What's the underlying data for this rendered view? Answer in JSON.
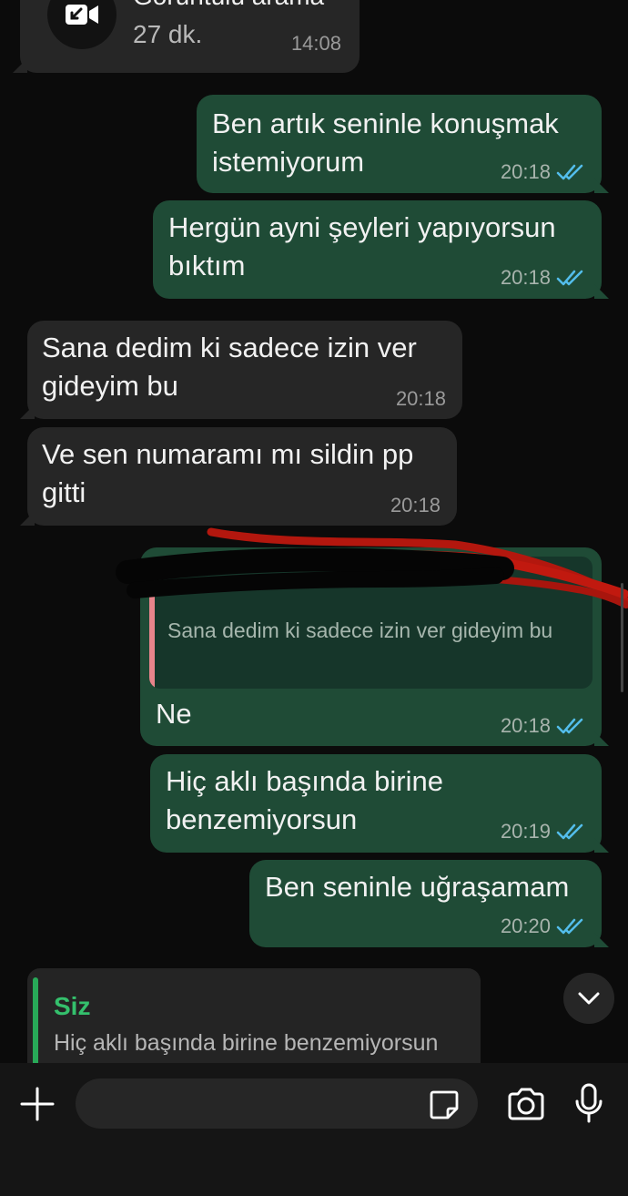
{
  "call": {
    "title": "Görüntülü arama",
    "duration": "27 dk.",
    "time": "14:08",
    "icon": "video-call-missed-icon"
  },
  "messages": [
    {
      "direction": "out",
      "text_line1": "Ben artık seninle konuşmak",
      "text_line2": "istemiyorum",
      "time": "20:18",
      "status": "read"
    },
    {
      "direction": "out",
      "text_line1": "Hergün ayni şeyleri yapıyorsun",
      "text_line2": "bıktım",
      "time": "20:18",
      "status": "read"
    },
    {
      "direction": "in",
      "text_line1": "Sana dedim ki sadece izin ver",
      "text_line2": "gideyim bu",
      "time": "20:18"
    },
    {
      "direction": "in",
      "text_line1": "Ve sen numaramı mı sildin pp",
      "text_line2": "gitti",
      "time": "20:18"
    },
    {
      "direction": "out",
      "quote": {
        "text": "Sana dedim ki sadece izin ver gideyim bu",
        "author": "[redacted]"
      },
      "text_line1": "Ne",
      "time": "20:18",
      "status": "read"
    },
    {
      "direction": "out",
      "text_line1": "Hiç aklı başında birine",
      "text_line2": "benzemiyorsun",
      "time": "20:19",
      "status": "read"
    },
    {
      "direction": "out",
      "text_line1": "Ben seninle uğraşamam",
      "time": "20:20",
      "status": "read"
    }
  ],
  "reply_preview": {
    "author": "Siz",
    "text": "Hiç aklı başında birine benzemiyorsun"
  },
  "input": {
    "placeholder": "",
    "value": ""
  },
  "colors": {
    "background": "#0b0b0b",
    "incoming_bubble": "#262626",
    "outgoing_bubble": "#1f4b36",
    "read_ticks": "#53bdeb",
    "reply_accent": "#34c06c",
    "quote_accent": "#e8848b"
  }
}
